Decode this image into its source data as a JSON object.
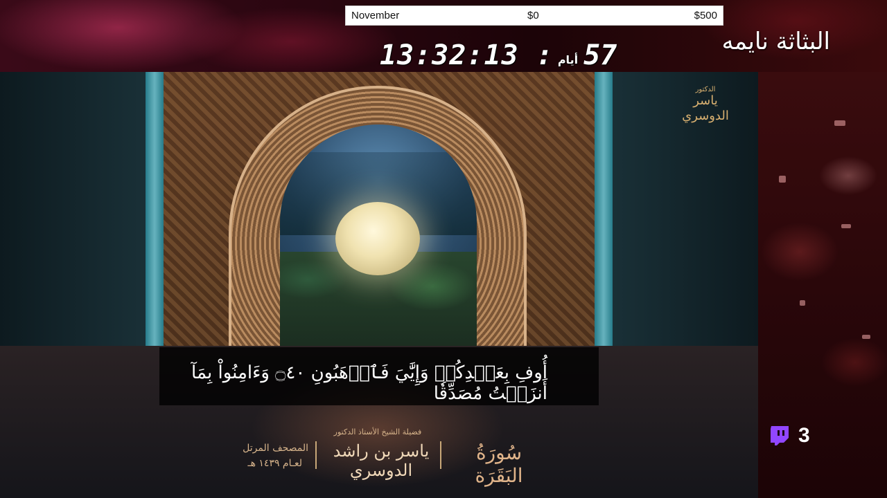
{
  "goal": {
    "month": "November",
    "current": "$0",
    "target": "$500"
  },
  "countdown": {
    "time": "13:32:13 :",
    "days_unit": "أيام",
    "days": "57"
  },
  "streamer_status": "البثاثة نايمه",
  "video": {
    "ayah_text": "أُوفِ بِعَهۡدِكُمۡ وَإِيَّٰيَ فَٱرۡهَبُونِ ۝٤٠ وَءَامِنُواْ بِمَآ أَنزَلۡتُ مُصَدِّقٗا",
    "surah_name": "سُورَةُ البَقَرَة",
    "reciter_title": "فضيلة الشيخ الأستاذ الدكتور",
    "reciter_name": "ياسر بن راشد الدوسري",
    "mushaf_line1": "المصحف المرتل",
    "mushaf_line2": "لعـام ١٤٣٩ هـ",
    "logo_title": "الدكتور",
    "logo_name": "ياسر الدوسري"
  },
  "viewers": {
    "count": "3",
    "icon": "twitch-icon",
    "brand_color": "#9146FF"
  }
}
